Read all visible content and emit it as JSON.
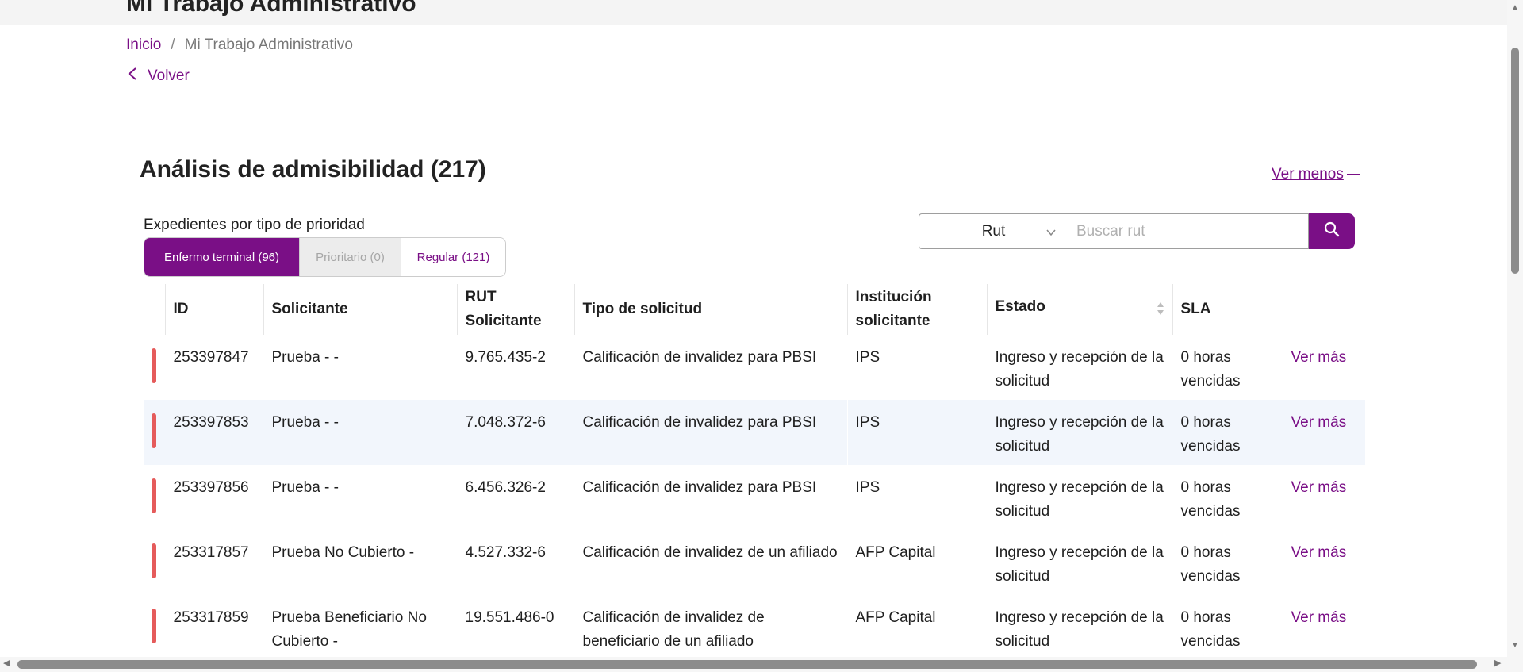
{
  "page": {
    "header_title": "Mi Trabajo Administrativo"
  },
  "breadcrumb": {
    "home": "Inicio",
    "separator": "/",
    "current": "Mi Trabajo Administrativo"
  },
  "back": {
    "label": "Volver",
    "icon": "chevron-left-icon"
  },
  "section": {
    "title": "Análisis de admisibilidad (217)",
    "toggle_label": "Ver menos"
  },
  "priority": {
    "label": "Expedientes por tipo de prioridad",
    "tabs": [
      {
        "label": "Enfermo terminal (96)",
        "state": "active"
      },
      {
        "label": "Prioritario (0)",
        "state": "disabled"
      },
      {
        "label": "Regular (121)",
        "state": "inactive"
      }
    ]
  },
  "search": {
    "field_value": "Rut",
    "placeholder": "Buscar rut",
    "icon": "search-icon"
  },
  "table": {
    "columns": {
      "id": "ID",
      "solicitante": "Solicitante",
      "rut_line1": "RUT",
      "rut_line2": "Solicitante",
      "tipo": "Tipo de solicitud",
      "institucion_line1": "Institución",
      "institucion_line2": "solicitante",
      "estado": "Estado",
      "sla": "SLA"
    },
    "rows": [
      {
        "id": "253397847",
        "solicitante": "Prueba - -",
        "rut": "9.765.435-2",
        "tipo": "Calificación de invalidez para PBSI",
        "institucion": "IPS",
        "estado": "Ingreso y recepción de la solicitud",
        "sla": "0 horas vencidas",
        "action": "Ver más"
      },
      {
        "id": "253397853",
        "solicitante": "Prueba - -",
        "rut": "7.048.372-6",
        "tipo": "Calificación de invalidez para PBSI",
        "institucion": "IPS",
        "estado": "Ingreso y recepción de la solicitud",
        "sla": "0 horas vencidas",
        "action": "Ver más"
      },
      {
        "id": "253397856",
        "solicitante": "Prueba - -",
        "rut": "6.456.326-2",
        "tipo": "Calificación de invalidez para PBSI",
        "institucion": "IPS",
        "estado": "Ingreso y recepción de la solicitud",
        "sla": "0 horas vencidas",
        "action": "Ver más"
      },
      {
        "id": "253317857",
        "solicitante": "Prueba No Cubierto -",
        "rut": "4.527.332-6",
        "tipo": "Calificación de invalidez de un afiliado",
        "institucion": "AFP Capital",
        "estado": "Ingreso y recepción de la solicitud",
        "sla": "0 horas vencidas",
        "action": "Ver más"
      },
      {
        "id": "253317859",
        "solicitante": "Prueba Beneficiario No Cubierto -",
        "rut": "19.551.486-0",
        "tipo": "Calificación de invalidez de beneficiario de un afiliado",
        "institucion": "AFP Capital",
        "estado": "Ingreso y recepción de la solicitud",
        "sla": "0 horas vencidas",
        "action": "Ver más"
      }
    ]
  },
  "colors": {
    "brand": "#7a0f86",
    "priority_marker": "#e55b5b",
    "row_highlight": "#f2f6fc"
  }
}
